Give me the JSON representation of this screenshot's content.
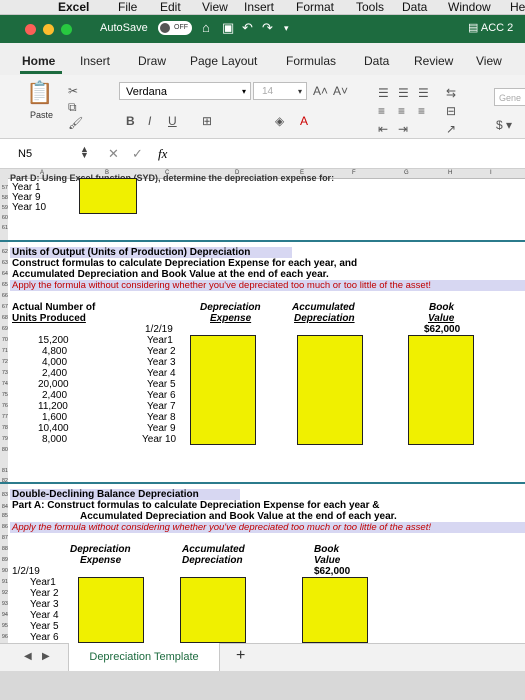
{
  "menubar": {
    "items": [
      "Excel",
      "File",
      "Edit",
      "View",
      "Insert",
      "Format",
      "Tools",
      "Data",
      "Window",
      "He"
    ]
  },
  "titlebar": {
    "autosave": "AutoSave",
    "off": "OFF",
    "account": "ACC 2"
  },
  "tabs": [
    "Home",
    "Insert",
    "Draw",
    "Page Layout",
    "Formulas",
    "Data",
    "Review",
    "View"
  ],
  "ribbon": {
    "paste": "Paste",
    "font": "Verdana",
    "size": "14",
    "number_format": "Gene"
  },
  "formula_bar": {
    "namebox": "N5",
    "fx": "fx"
  },
  "columns": [
    "A",
    "B",
    "C",
    "D",
    "E",
    "F",
    "G",
    "H",
    "I"
  ],
  "cut_header": "Part D: Using Excel function (SYD), determine the depreciation expense for:",
  "rows_top": {
    "r57": "Year 1",
    "r58": "Year 9",
    "r59": "Year 10"
  },
  "uop": {
    "title": "Units of Output (Units of Production) Depreciation",
    "line1": "Construct formulas to calculate Depreciation Expense for each year, and",
    "line2": "Accumulated Depreciation and Book Value at the end of each year.",
    "line3": "Apply the formula without considering whether you've depreciated too much or too little of the asset!",
    "col_actual": "Actual Number of",
    "col_units": "Units Produced",
    "col_dep1": "Depreciation",
    "col_dep2": "Expense",
    "col_acc1": "Accumulated",
    "col_acc2": "Depreciation",
    "col_book1": "Book",
    "col_book2": "Value",
    "start_date": "1/2/19",
    "book_start": "$62,000",
    "units": [
      "15,200",
      "4,800",
      "4,000",
      "2,400",
      "20,000",
      "2,400",
      "11,200",
      "1,600",
      "10,400",
      "8,000"
    ],
    "years": [
      "Year1",
      "Year 2",
      "Year 3",
      "Year 4",
      "Year 5",
      "Year 6",
      "Year 7",
      "Year 8",
      "Year 9",
      "Year 10"
    ]
  },
  "ddb": {
    "title": "Double-Declining Balance Depreciation",
    "line1": "Part A: Construct formulas to calculate Depreciation Expense for each year &",
    "line2": "Accumulated Depreciation and Book Value at the end of each year.",
    "line3": "Apply the formula without considering whether you've depreciated too much or too little of the asset!",
    "col_dep1": "Depreciation",
    "col_dep2": "Expense",
    "col_acc1": "Accumulated",
    "col_acc2": "Depreciation",
    "col_book1": "Book",
    "col_book2": "Value",
    "start_date": "1/2/19",
    "book_start": "$62,000",
    "years": [
      "Year1",
      "Year 2",
      "Year 3",
      "Year 4",
      "Year 5",
      "Year 6"
    ]
  },
  "row_numbers": [
    "57",
    "58",
    "59",
    "60",
    "61",
    "62",
    "63",
    "64",
    "65",
    "66",
    "67",
    "68",
    "69",
    "70",
    "71",
    "72",
    "73",
    "74",
    "75",
    "76",
    "77",
    "78",
    "79",
    "80",
    "81",
    "82",
    "83",
    "84",
    "85",
    "86",
    "87",
    "88",
    "89",
    "90",
    "91",
    "92",
    "93",
    "94",
    "95",
    "96"
  ],
  "sheet_tab": "Depreciation Template",
  "add_sheet": "+",
  "colors": {
    "excel_green": "#1d6b3f",
    "highlight_yellow": "#f0f000",
    "teal": "#2b7b8c",
    "red_text": "#c00000"
  }
}
